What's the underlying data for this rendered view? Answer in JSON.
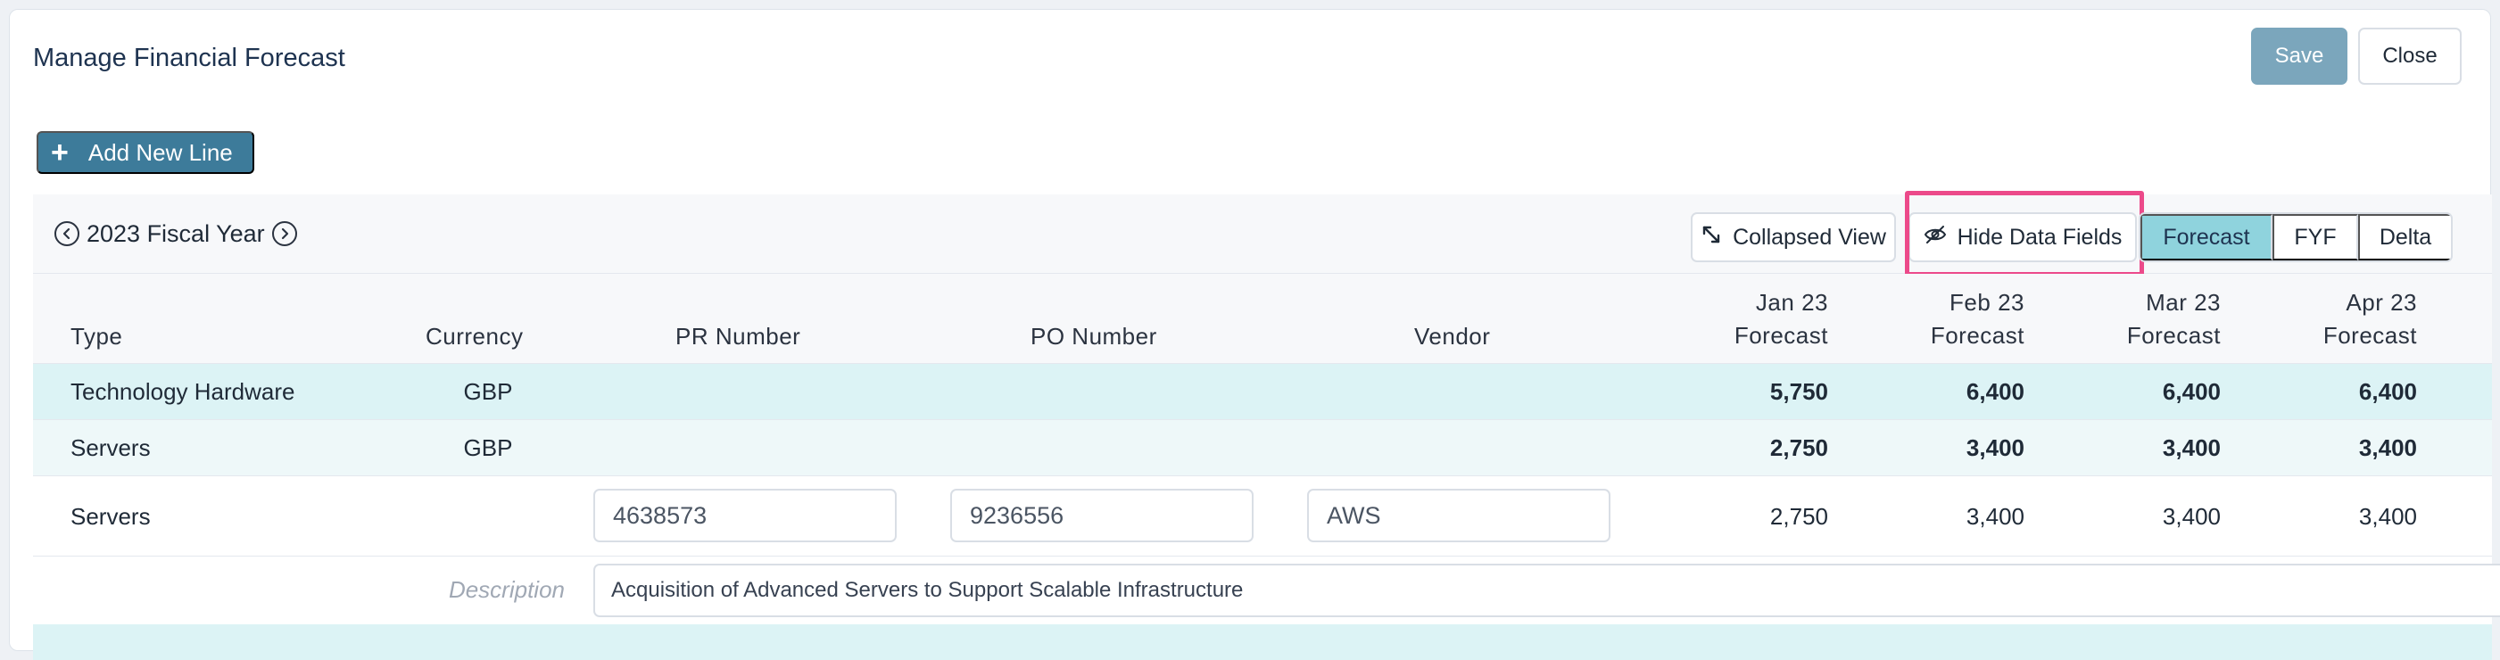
{
  "page": {
    "title": "Manage Financial Forecast",
    "save_label": "Save",
    "close_label": "Close",
    "add_line_label": "Add New Line"
  },
  "toolbar": {
    "fiscal_year": "2023 Fiscal Year",
    "collapsed_view_label": "Collapsed View",
    "hide_data_fields_label": "Hide Data Fields",
    "views": [
      {
        "label": "Forecast",
        "active": true
      },
      {
        "label": "FYF",
        "active": false
      },
      {
        "label": "Delta",
        "active": false
      }
    ]
  },
  "columns": {
    "type": "Type",
    "currency": "Currency",
    "pr_number": "PR Number",
    "po_number": "PO Number",
    "vendor": "Vendor",
    "months": [
      {
        "month": "Jan 23",
        "sub": "Forecast"
      },
      {
        "month": "Feb 23",
        "sub": "Forecast"
      },
      {
        "month": "Mar 23",
        "sub": "Forecast"
      },
      {
        "month": "Apr 23",
        "sub": "Forecast"
      }
    ]
  },
  "rows": [
    {
      "type": "Technology Hardware",
      "currency": "GBP",
      "values": [
        "5,750",
        "6,400",
        "6,400",
        "6,400"
      ]
    },
    {
      "type": "Servers",
      "currency": "GBP",
      "values": [
        "2,750",
        "3,400",
        "3,400",
        "3,400"
      ]
    },
    {
      "type": "Servers",
      "currency": "",
      "pr_number": "4638573",
      "po_number": "9236556",
      "vendor": "AWS",
      "values": [
        "2,750",
        "3,400",
        "3,400",
        "3,400"
      ]
    }
  ],
  "description": {
    "label": "Description",
    "value": "Acquisition of Advanced Servers to Support Scalable Infrastructure"
  },
  "colors": {
    "accent": "#3d7b9a",
    "save_disabled": "#7ba6bc",
    "active_view": "#8fd3dd",
    "row_group": "#dcf3f5",
    "row_subgroup": "#eef8f9",
    "highlight": "#ec4a8a"
  }
}
